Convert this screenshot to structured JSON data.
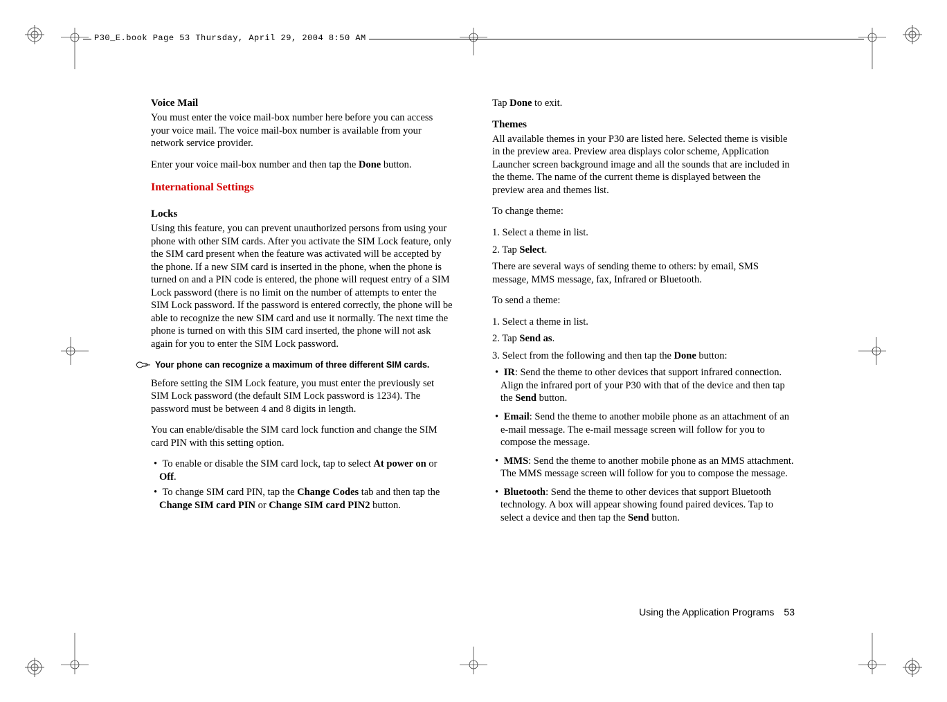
{
  "header": {
    "meta_line": "P30_E.book  Page 53  Thursday, April 29, 2004  8:50 AM"
  },
  "left": {
    "voicemail_h": "Voice Mail",
    "voicemail_p1": "You must enter the voice mail-box number here before you can access your voice mail. The voice mail-box number is available from your network service provider.",
    "voicemail_p2a": "Enter your voice mail-box number and then tap the ",
    "voicemail_p2b": "Done",
    "voicemail_p2c": " button.",
    "intl_h": "International Settings",
    "locks_h": "Locks",
    "locks_p1": "Using this feature, you can prevent unauthorized persons from using your phone with other SIM cards. After you activate the SIM Lock feature, only the SIM card present when the feature was activated will be accepted by the phone. If a new SIM card is inserted in the phone, when the phone is turned on and a PIN code is entered, the phone will request entry of a SIM Lock password (there is no limit on the number of attempts to enter the SIM Lock password. If the password is entered correctly, the phone will be able to recognize the new SIM card and use it normally. The next time the phone is turned on with this SIM card inserted, the phone will not ask again for you to enter the SIM Lock password.",
    "note": "Your phone can recognize a maximum of three different SIM cards.",
    "locks_p2": "Before setting the SIM Lock feature, you must enter the previously set SIM Lock password (the default SIM Lock password is 1234). The password must be between 4 and 8 digits in length.",
    "locks_p3": "You can enable/disable the SIM card lock function and change the SIM card PIN with this setting option.",
    "bul1a": "To enable or disable the SIM card lock, tap to select ",
    "bul1b": "At power on",
    "bul1c": " or ",
    "bul1d": "Off",
    "bul1e": ".",
    "bul2a": "To change SIM card PIN, tap the ",
    "bul2b": "Change Codes",
    "bul2c": " tab and then tap the ",
    "bul2d": "Change SIM card PIN",
    "bul2e": " or ",
    "bul2f": "Change SIM card PIN2",
    "bul2g": " button."
  },
  "right": {
    "tap_done_a": "Tap ",
    "tap_done_b": "Done",
    "tap_done_c": " to exit.",
    "themes_h": "Themes",
    "themes_p1": "All available themes in your P30 are listed here. Selected theme is visible in the preview area. Preview area displays color scheme, Application Launcher screen background image and all the sounds that are included in the theme. The name of the current theme is displayed between the preview area and themes list.",
    "change_intro": "To change theme:",
    "change_1": "1. Select a theme in list.",
    "change_2a": "2. Tap ",
    "change_2b": "Select",
    "change_2c": ".",
    "send_blurb": "There are several ways of sending theme to others: by email, SMS message, MMS message, fax, Infrared or Bluetooth.",
    "send_intro": "To send a theme:",
    "send_1": "1. Select a theme in list.",
    "send_2a": "2. Tap ",
    "send_2b": "Send as",
    "send_2c": ".",
    "send_3a": "3. Select from the following and then tap the ",
    "send_3b": "Done",
    "send_3c": " button:",
    "ir_b": "IR",
    "ir_t": ": Send the theme to other devices that support infrared connection. Align the infrared port of your P30 with that of the device and then tap the ",
    "ir_send": "Send",
    "ir_end": " button.",
    "email_b": "Email",
    "email_t": ": Send the theme to another mobile phone as an attachment of an e-mail message. The e-mail message screen will follow for you to compose the message.",
    "mms_b": "MMS",
    "mms_t": ": Send the theme to another mobile phone as an MMS attachment. The MMS message screen will follow for you to compose the message.",
    "bt_b": "Bluetooth",
    "bt_t": ": Send the theme to other devices that support Bluetooth technology. A box will appear showing found paired devices. Tap to select a device and then tap the ",
    "bt_send": "Send",
    "bt_end": " button."
  },
  "footer": {
    "title": "Using the Application Programs",
    "page": "53"
  }
}
